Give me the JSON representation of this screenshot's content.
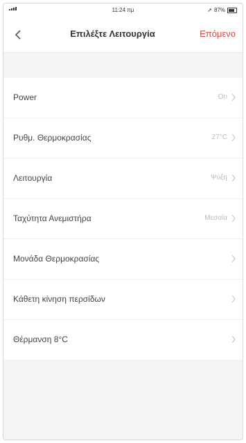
{
  "status_bar": {
    "time": "11:24 πμ",
    "battery": "87%"
  },
  "header": {
    "title": "Επιλέξτε Λειτουργία",
    "next_label": "Επόμενο"
  },
  "settings": [
    {
      "label": "Power",
      "value": "On"
    },
    {
      "label": "Ρυθμ. Θερμοκρασίας",
      "value": "27°C"
    },
    {
      "label": "Λειτουργία",
      "value": "Ψύξη"
    },
    {
      "label": "Ταχύτητα Ανεμιστήρα",
      "value": "Μεσαία"
    },
    {
      "label": "Μονάδα Θερμοκρασίας",
      "value": ""
    },
    {
      "label": "Κάθετη κίνηση περσίδων",
      "value": ""
    },
    {
      "label": "Θέρμανση 8°C",
      "value": ""
    }
  ],
  "colors": {
    "accent": "#e0443a",
    "background": "#f4f4f4"
  }
}
